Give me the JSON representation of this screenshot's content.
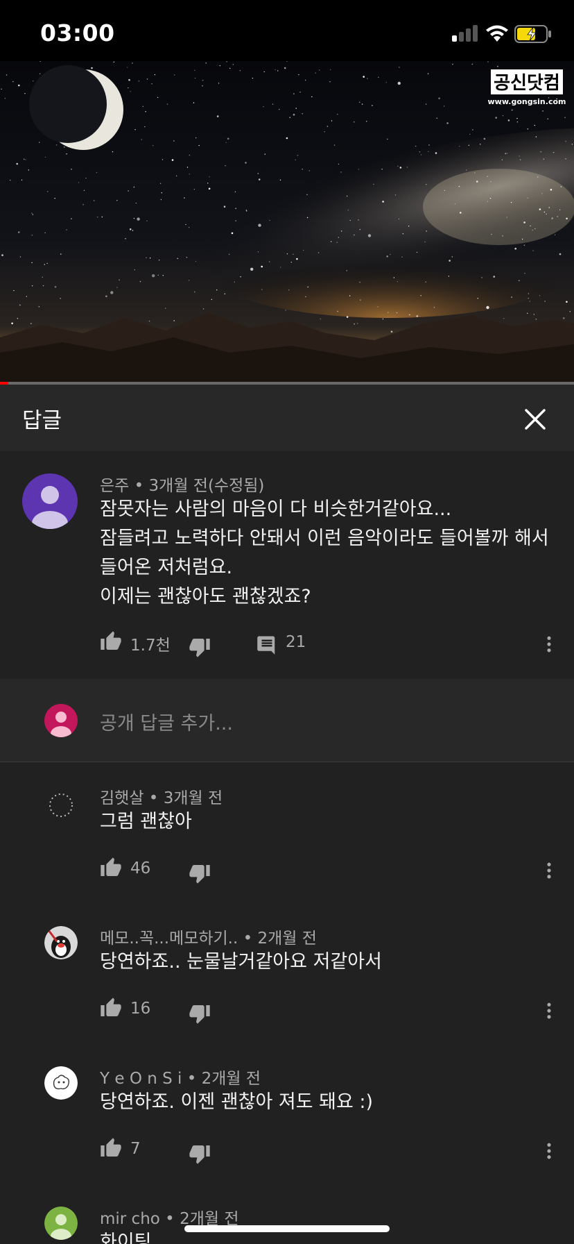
{
  "status_bar": {
    "time": "03:00"
  },
  "video": {
    "watermark_title": "공신닷컴",
    "watermark_url": "www.gongsin.com",
    "progress": 0.015
  },
  "replies_panel": {
    "title": "답글",
    "close_icon": "close-icon"
  },
  "parent_comment": {
    "author": "은주",
    "time": "3개월 전(수정됨)",
    "lines": [
      "잠못자는 사람의 마음이 다 비슷한거같아요...",
      "잠들려고 노력하다 안돼서 이런 음악이라도 들어볼까 해서",
      "들어온 저처럼요.",
      "이제는 괜찮아도 괜찮겠죠?"
    ],
    "likes": "1.7천",
    "replies": "21"
  },
  "reply_box": {
    "placeholder": "공개 답글 추가..."
  },
  "replies": [
    {
      "author": "김햇살",
      "time": "3개월 전",
      "text": "그럼 괜찮아",
      "likes": "46"
    },
    {
      "author": "메모..꼭...메모하기..",
      "time": "2개월 전",
      "text": "당연하죠.. 눈물날거같아요 저같아서",
      "likes": "16"
    },
    {
      "author": "Y e O n S i",
      "time": "2개월 전",
      "text": "당연하죠. 이젠 괜찮아 져도 돼요 :)",
      "likes": "7"
    },
    {
      "author": "mir cho",
      "time": "2개월 전",
      "text": "화이팅"
    }
  ],
  "colors": {
    "background": "#212121",
    "header": "#282828",
    "meta": "#aaaaaa",
    "progress": "#ff0000"
  }
}
